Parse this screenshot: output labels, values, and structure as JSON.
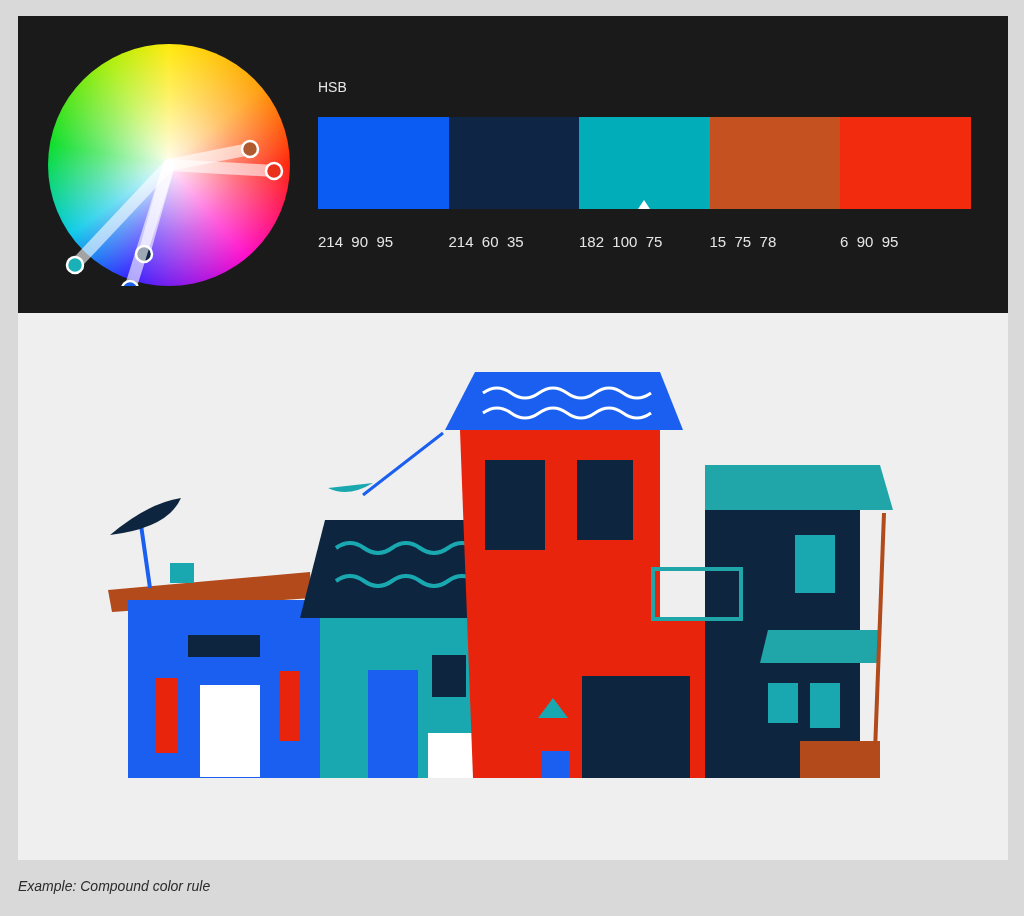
{
  "palette_panel": {
    "mode_label": "HSB",
    "swatches": [
      {
        "color": "#0a5cf2",
        "values": "214  90  95",
        "selected": false
      },
      {
        "color": "#0e2545",
        "values": "214  60  35",
        "selected": false
      },
      {
        "color": "#00adb8",
        "values": "182  100  75",
        "selected": true
      },
      {
        "color": "#c55020",
        "values": "15  75  78",
        "selected": false
      },
      {
        "color": "#f22b0f",
        "values": "6  90  95",
        "selected": false
      }
    ]
  },
  "caption": "Example: Compound color rule"
}
